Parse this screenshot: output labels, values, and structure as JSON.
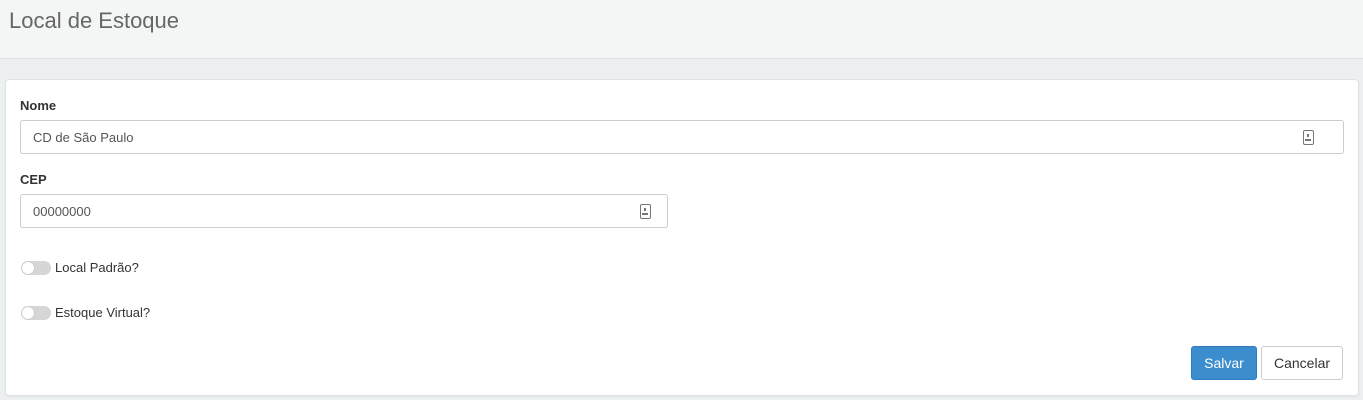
{
  "header": {
    "title": "Local de Estoque"
  },
  "form": {
    "nome": {
      "label": "Nome",
      "value": "CD de São Paulo",
      "icon": "contact-card-icon"
    },
    "cep": {
      "label": "CEP",
      "value": "00000000",
      "icon": "contact-card-icon"
    },
    "local_padrao": {
      "label": "Local Padrão?",
      "checked": false
    },
    "estoque_virtual": {
      "label": "Estoque Virtual?",
      "checked": false
    }
  },
  "actions": {
    "save_label": "Salvar",
    "cancel_label": "Cancelar"
  },
  "colors": {
    "primary": "#3c8dce",
    "background": "#ecf0f1"
  }
}
